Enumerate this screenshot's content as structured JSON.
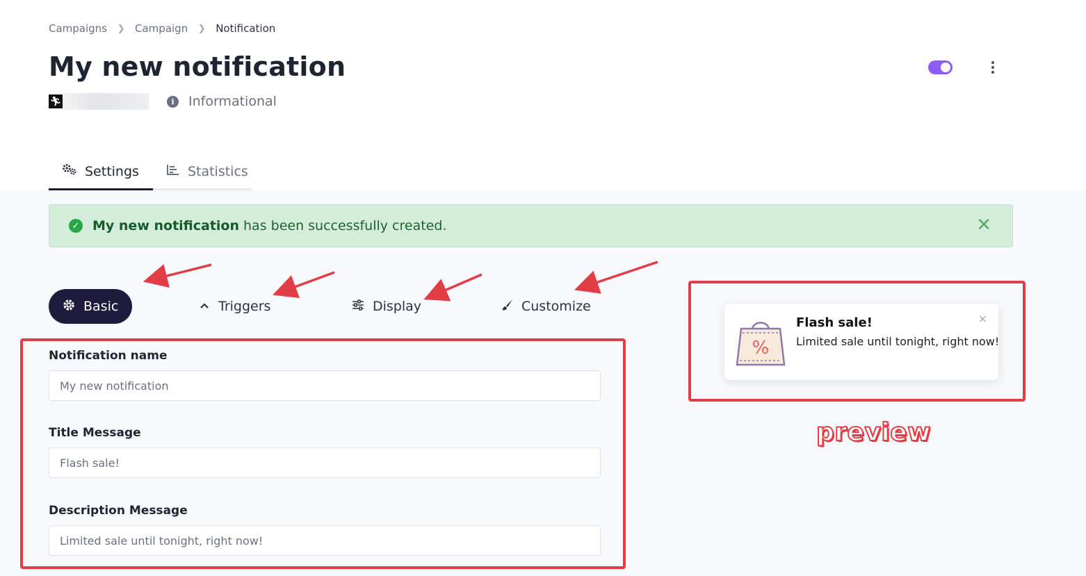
{
  "breadcrumb": {
    "items": [
      "Campaigns",
      "Campaign",
      "Notification"
    ]
  },
  "header": {
    "title": "My new notification",
    "site_icon": "runner-favicon-icon",
    "type_label": "Informational",
    "toggle_on": true
  },
  "tabs": [
    {
      "label": "Settings",
      "icon": "gears-icon",
      "active": true
    },
    {
      "label": "Statistics",
      "icon": "bar-chart-icon",
      "active": false
    }
  ],
  "alert": {
    "strong": "My new notification",
    "text": "has been successfully created."
  },
  "subtabs": [
    {
      "label": "Basic",
      "icon": "gear-icon",
      "active": true
    },
    {
      "label": "Triggers",
      "icon": "chevron-up-icon",
      "active": false
    },
    {
      "label": "Display",
      "icon": "sliders-icon",
      "active": false
    },
    {
      "label": "Customize",
      "icon": "paintbrush-icon",
      "active": false
    }
  ],
  "form": {
    "name_label": "Notification name",
    "name_value": "My new notification",
    "title_label": "Title Message",
    "title_value": "Flash sale!",
    "desc_label": "Description Message",
    "desc_value": "Limited sale until tonight, right now!"
  },
  "preview": {
    "title": "Flash sale!",
    "description": "Limited sale until tonight, right now!",
    "close": "×",
    "annotation": "preview"
  },
  "colors": {
    "accent": "#8b5cf6",
    "dark": "#1f1b3d",
    "success_bg": "#d4edda",
    "annotation_red": "#e23d44"
  }
}
